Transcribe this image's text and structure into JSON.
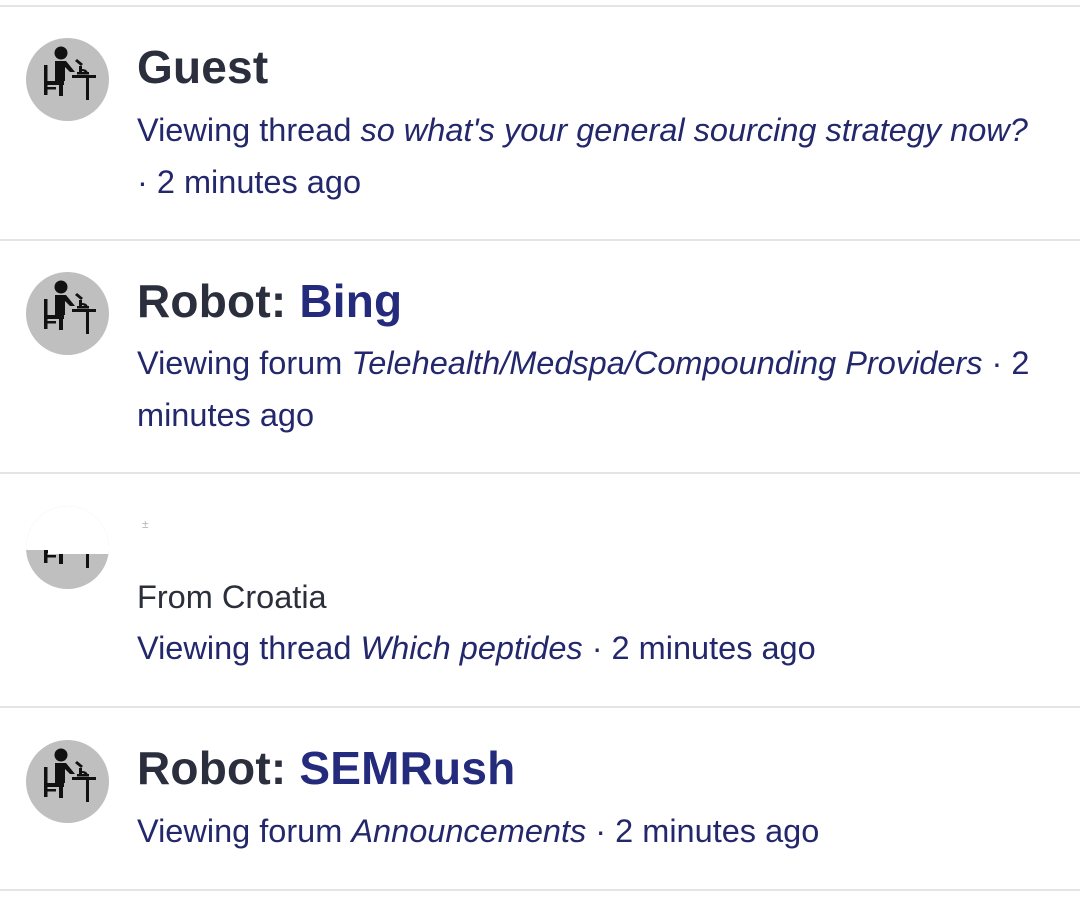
{
  "rows": [
    {
      "name": "Guest",
      "action": "Viewing thread",
      "target": "so what's your general sourcing strategy now?",
      "time": "2 minutes ago"
    },
    {
      "prefix": "Robot:",
      "bot_name": "Bing",
      "action": "Viewing forum",
      "target": "Telehealth/Medspa/Compounding Providers",
      "time": "2 minutes ago"
    },
    {
      "name_mark": "±",
      "from": "From Croatia",
      "action": "Viewing thread",
      "target": "Which peptides",
      "time": "2 minutes ago"
    },
    {
      "prefix": "Robot:",
      "bot_name": "SEMRush",
      "action": "Viewing forum",
      "target": "Announcements",
      "time": "2 minutes ago"
    }
  ],
  "separator": "·",
  "colors": {
    "name_text": "#2a2e3d",
    "bot_name": "#242b7d",
    "info_text": "#23276b",
    "divider": "#e3e4e8",
    "avatar_bg": "#bfbfbf"
  },
  "icons": {
    "avatar": "scientist-microscope-icon"
  }
}
